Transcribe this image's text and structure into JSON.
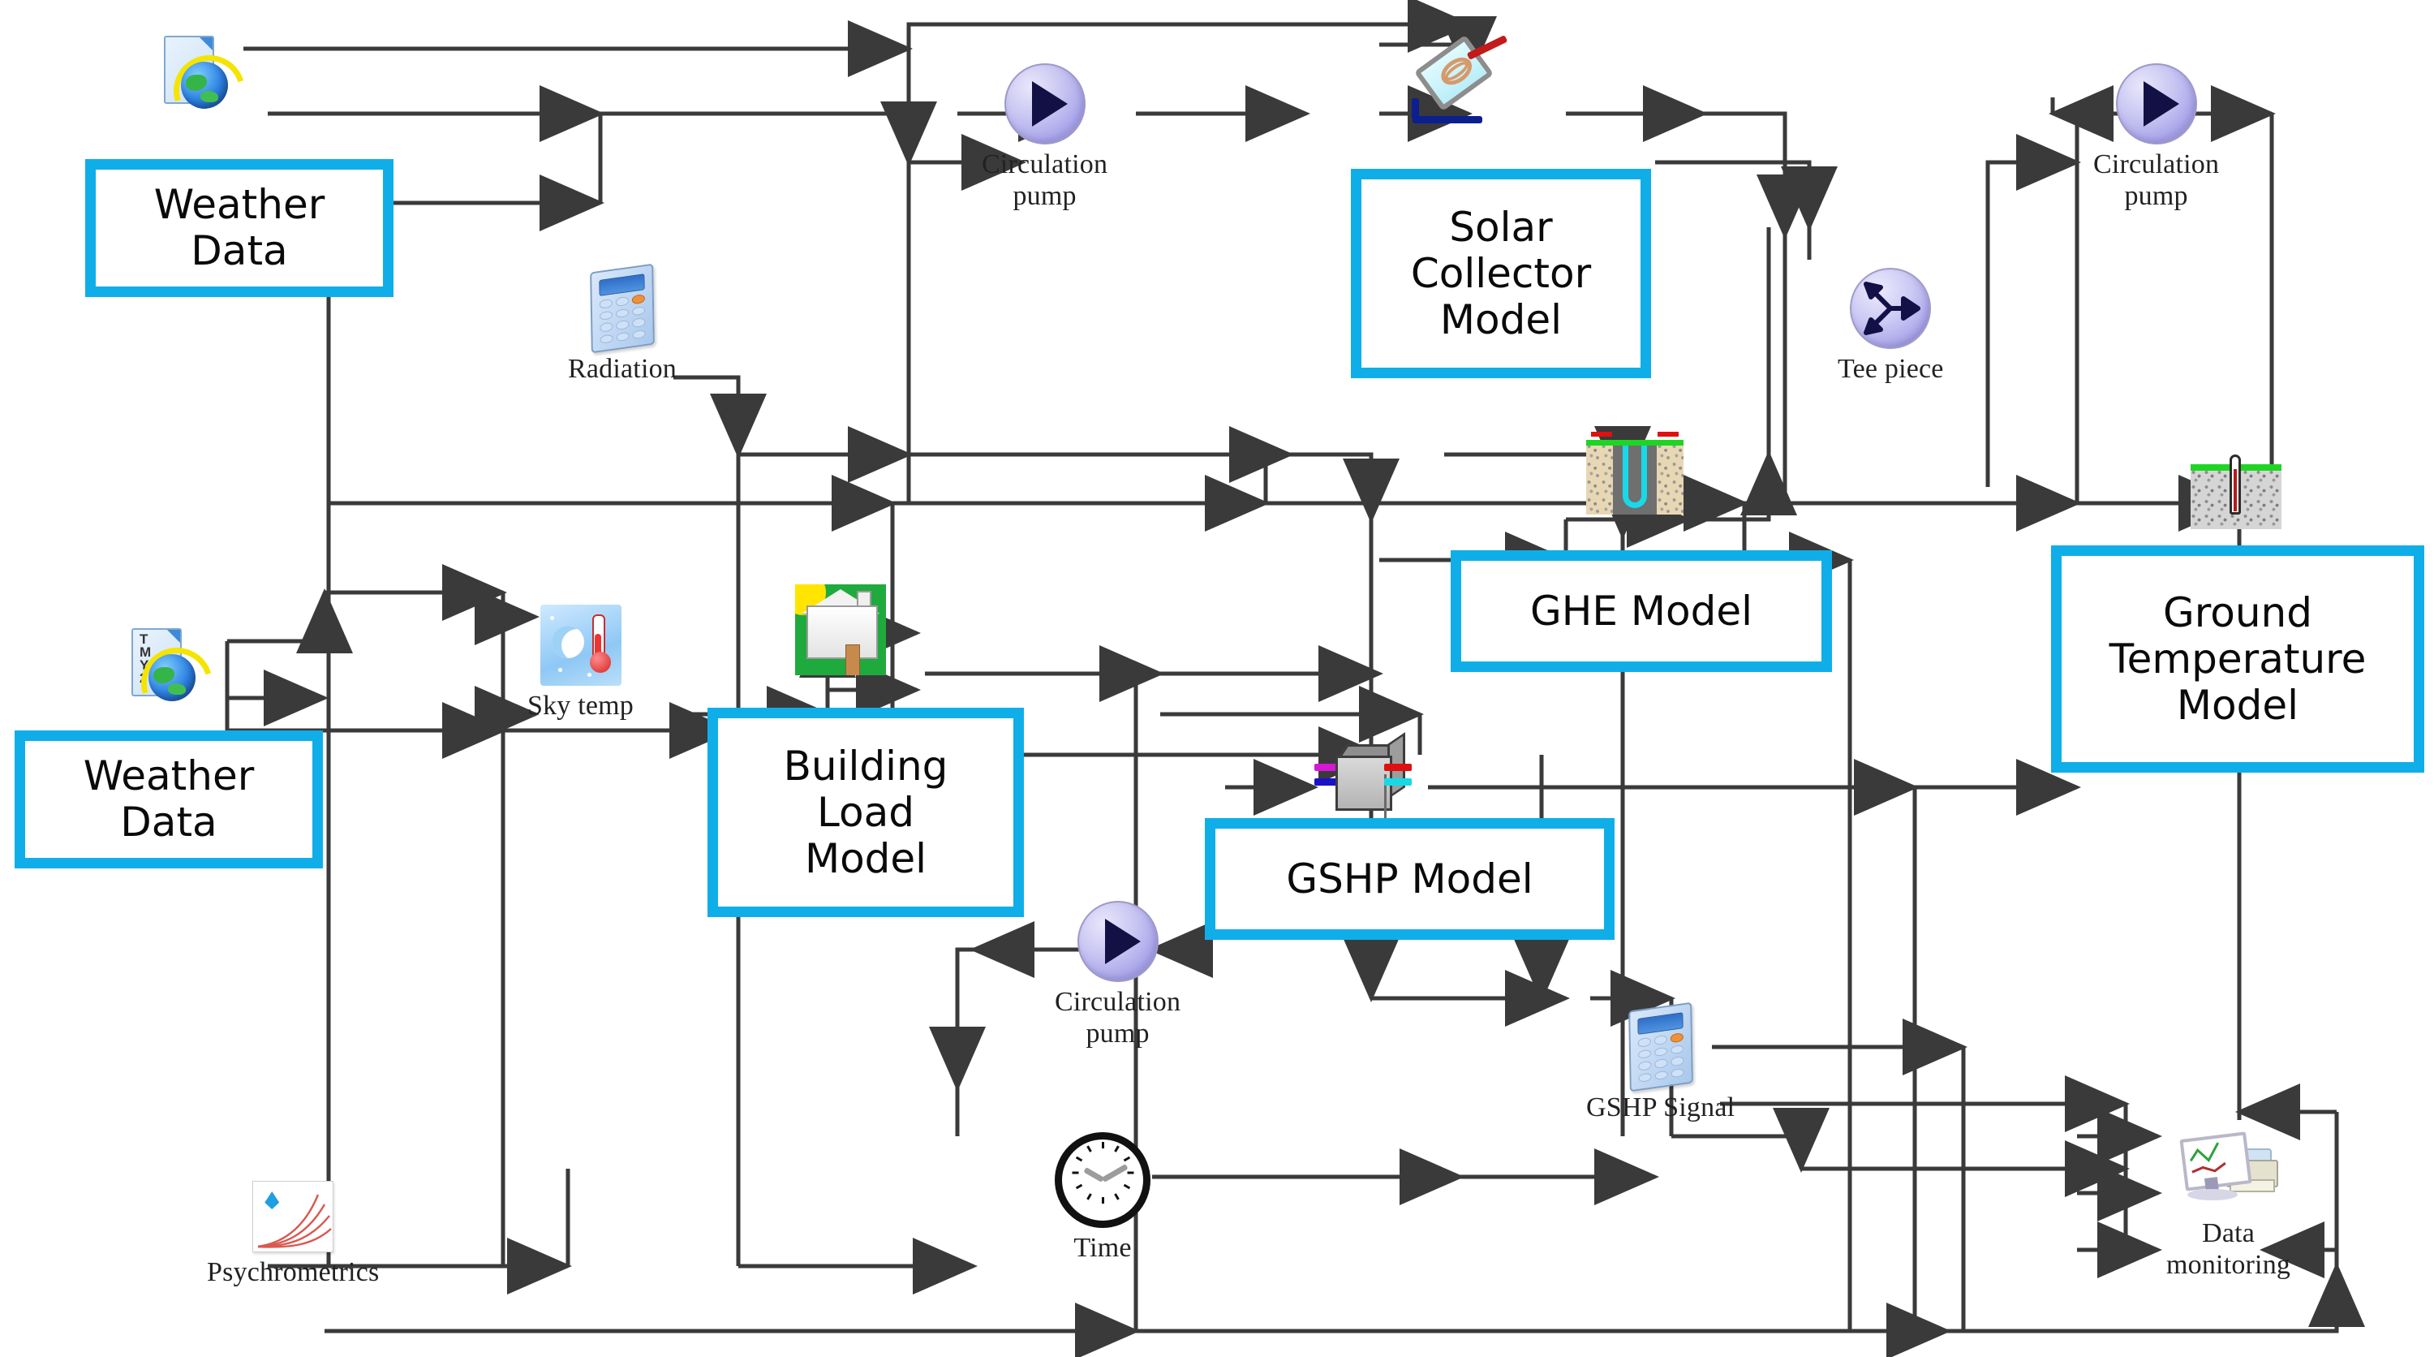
{
  "diagram": {
    "title": "TRNSYS solar-assisted ground source heat pump simulation schematic",
    "accent_color": "#10aee8",
    "wire_color": "#3a3a3a",
    "background": "#ffffff"
  },
  "components": [
    {
      "id": "weather_top",
      "icon": "weather-file-globe-icon",
      "caption": ""
    },
    {
      "id": "weather_bottom",
      "icon": "tmy2-weather-file-globe-icon",
      "caption": ""
    },
    {
      "id": "radiation",
      "icon": "calculator-icon",
      "caption": "Radiation"
    },
    {
      "id": "sky_temp",
      "icon": "sky-temperature-icon",
      "caption": "Sky temp"
    },
    {
      "id": "psychrometrics",
      "icon": "psychrometric-chart-icon",
      "caption": "Psychrometrics"
    },
    {
      "id": "building",
      "icon": "building-house-icon",
      "caption": ""
    },
    {
      "id": "pump_solar",
      "icon": "pump-icon",
      "caption": "Circulation\npump"
    },
    {
      "id": "pump_ground",
      "icon": "pump-icon",
      "caption": "Circulation\npump"
    },
    {
      "id": "pump_load",
      "icon": "pump-icon",
      "caption": "Circulation\npump"
    },
    {
      "id": "solar_collector",
      "icon": "solar-collector-icon",
      "caption": ""
    },
    {
      "id": "tee_piece",
      "icon": "tee-piece-icon",
      "caption": "Tee piece"
    },
    {
      "id": "ghe",
      "icon": "borehole-heat-exchanger-icon",
      "caption": ""
    },
    {
      "id": "ground_temp",
      "icon": "ground-thermometer-icon",
      "caption": ""
    },
    {
      "id": "gshp",
      "icon": "heat-pump-box-icon",
      "caption": ""
    },
    {
      "id": "gshp_signal",
      "icon": "calculator-icon",
      "caption": "GSHP Signal"
    },
    {
      "id": "time",
      "icon": "clock-icon",
      "caption": "Time"
    },
    {
      "id": "data_monitoring",
      "icon": "monitor-printer-icon",
      "caption": "Data\nmonitoring"
    }
  ],
  "callouts": [
    {
      "id": "weather_data_top",
      "label": "Weather\nData"
    },
    {
      "id": "weather_data_bottom",
      "label": "Weather\nData"
    },
    {
      "id": "solar_collector_model",
      "label": "Solar\nCollector\nModel"
    },
    {
      "id": "building_load_model",
      "label": "Building\nLoad\nModel"
    },
    {
      "id": "ghe_model",
      "label": "GHE Model"
    },
    {
      "id": "gshp_model",
      "label": "GSHP Model"
    },
    {
      "id": "ground_temperature_model",
      "label": "Ground\nTemperature\nModel"
    }
  ],
  "captions": {
    "radiation": "Radiation",
    "sky_temp": "Sky temp",
    "psychrometrics": "Psychrometrics",
    "pump": "Circulation\npump",
    "tee_piece": "Tee piece",
    "gshp_signal": "GSHP Signal",
    "time": "Time",
    "data_monitoring": "Data\nmonitoring"
  }
}
